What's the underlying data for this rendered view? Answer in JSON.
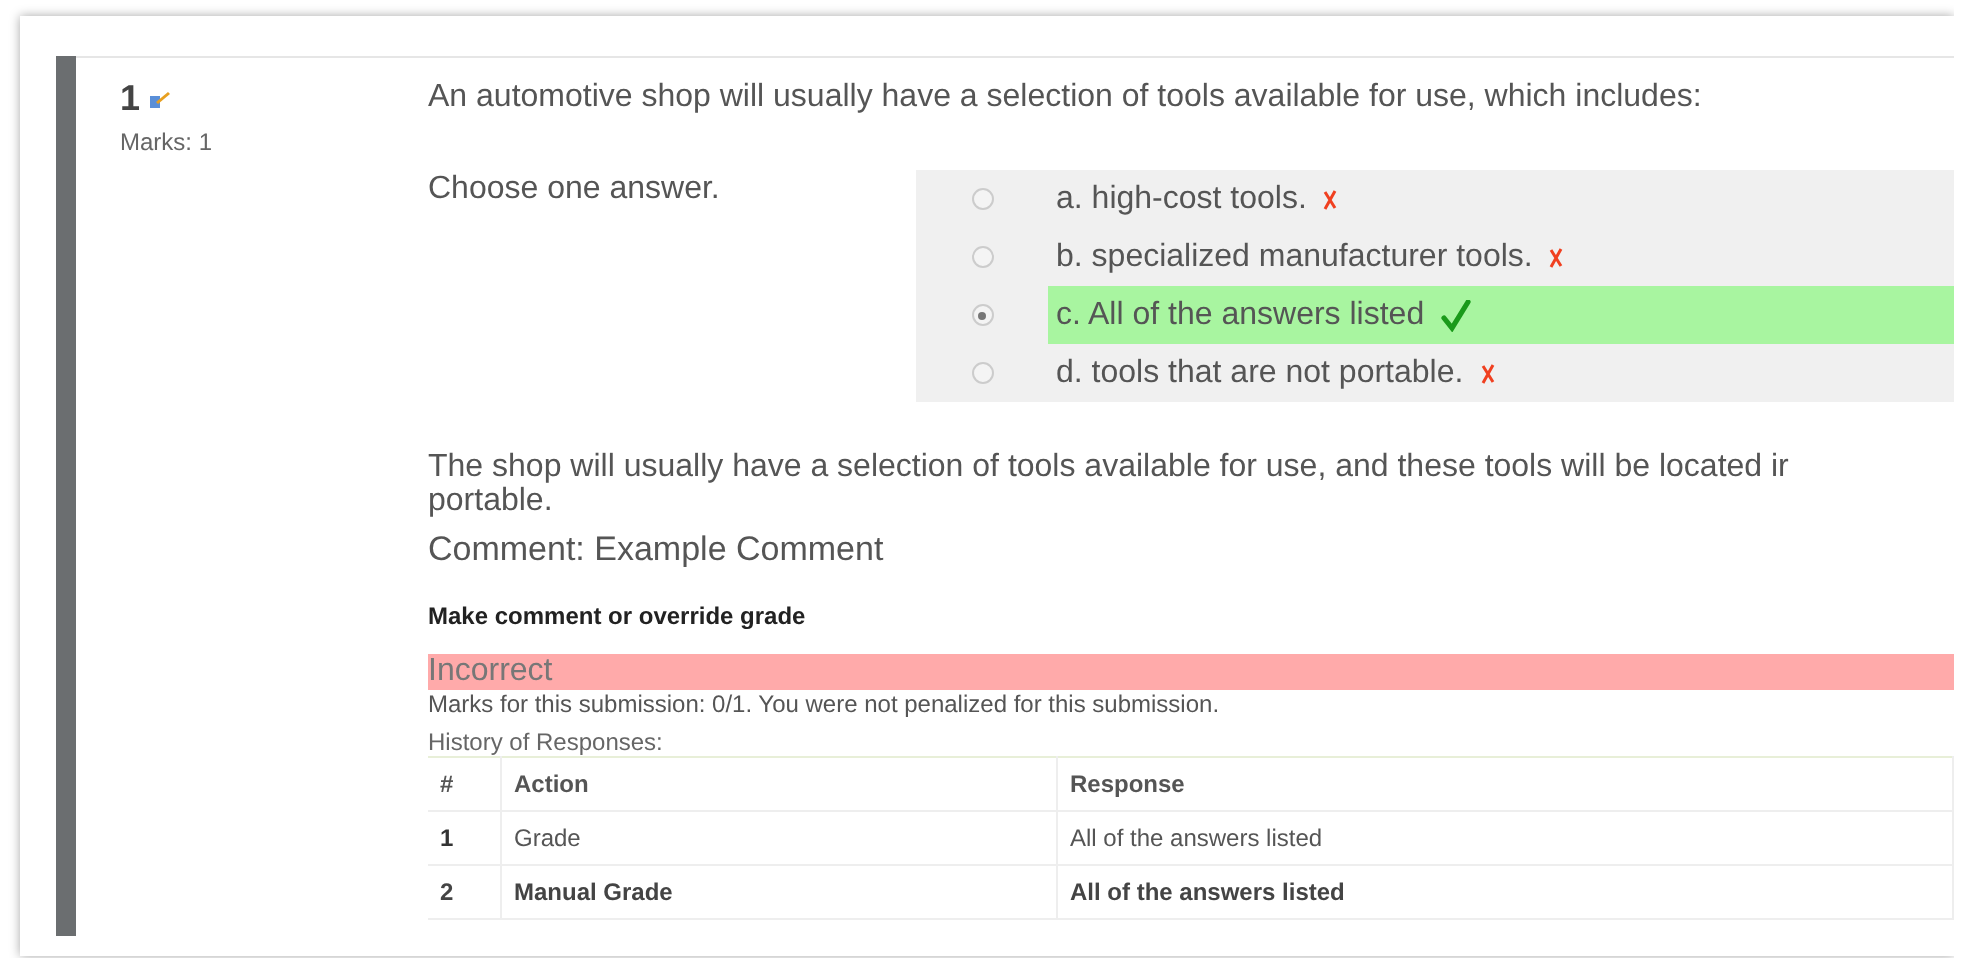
{
  "question": {
    "number": "1",
    "marks": "Marks: 1",
    "text": "An automotive shop will usually have a selection of tools available for use, which includes:",
    "prompt": "Choose one answer.",
    "answers": [
      {
        "label": "a. high-cost tools.",
        "selected": false,
        "kind": "incorrect"
      },
      {
        "label": "b. specialized manufacturer tools.",
        "selected": false,
        "kind": "incorrect"
      },
      {
        "label": "c. All of the answers listed",
        "selected": true,
        "kind": "correct"
      },
      {
        "label": "d. tools that are not portable.",
        "selected": false,
        "kind": "incorrect"
      }
    ],
    "feedback_lines": [
      "The shop will usually have a selection of tools available for use, and these tools will be located ir",
      "portable."
    ],
    "comment": "Comment: Example Comment",
    "override_link": "Make comment or override grade",
    "grade_status": "Incorrect",
    "marks_note": "Marks for this submission: 0/1. You were not penalized for this submission.",
    "history": {
      "title": "History of Responses:",
      "columns": [
        "#",
        "Action",
        "Response"
      ],
      "rows": [
        {
          "cells": [
            "1",
            "Grade",
            "All of the answers listed"
          ],
          "current": false
        },
        {
          "cells": [
            "2",
            "Manual Grade",
            "All of the answers listed"
          ],
          "current": true
        }
      ]
    }
  }
}
